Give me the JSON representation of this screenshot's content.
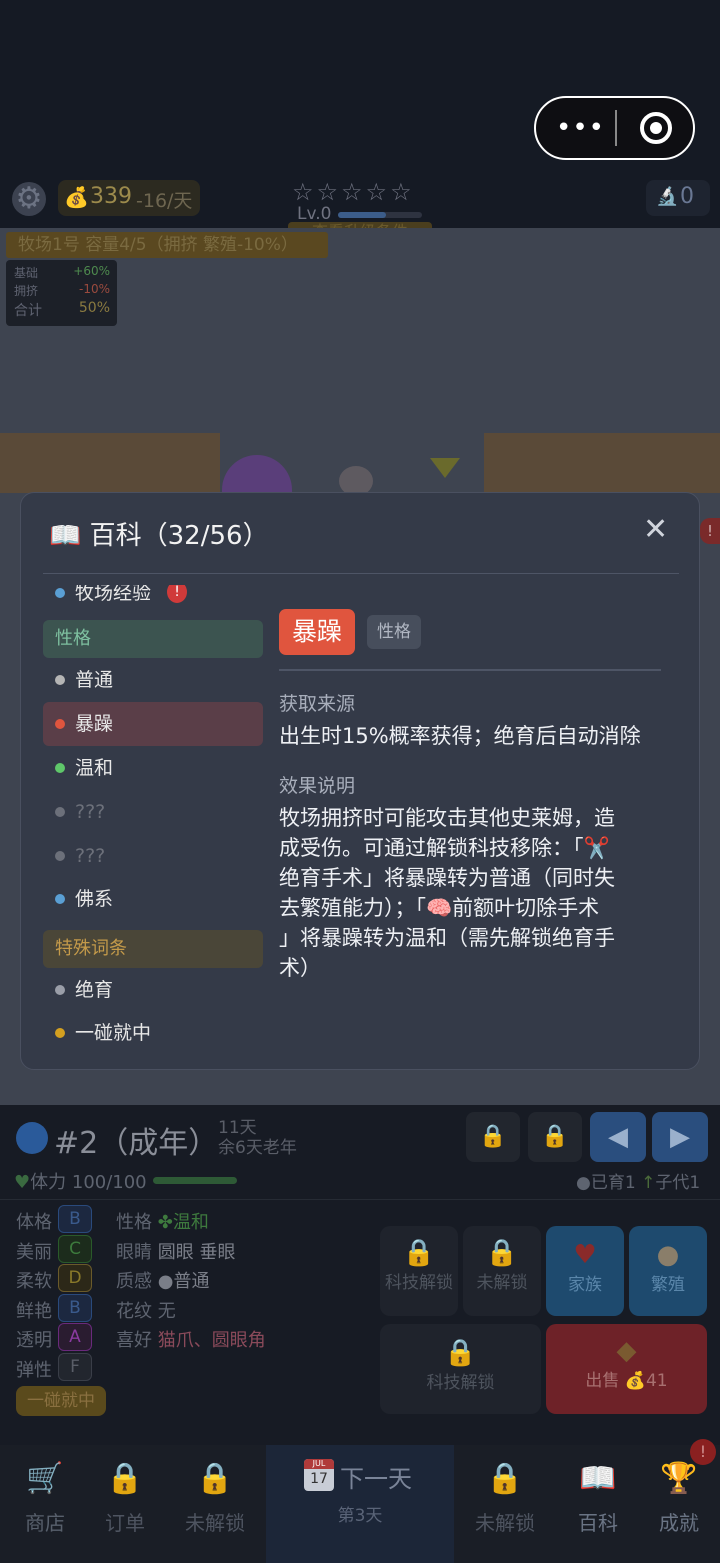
{
  "top": {
    "coins": "339",
    "coins_delta": "-16/天",
    "stars": "☆☆☆☆☆",
    "level": "Lv.0",
    "upgrade_label": "查看升级条件",
    "right_count": "0"
  },
  "farm": {
    "label": "牧场1号  容量4/5（拥挤 繁殖-10%）",
    "stats": [
      {
        "name": "基础",
        "value": "+60%"
      },
      {
        "name": "拥挤",
        "value": "-10%"
      },
      {
        "name": "合计",
        "value": "50%"
      }
    ]
  },
  "modal": {
    "title": "百科（32/56）",
    "close": "✕",
    "sidebar": {
      "partial_item": "牧场经验",
      "cat_personality": "性格",
      "items": [
        {
          "label": "普通",
          "color": "#b5b5b5"
        },
        {
          "label": "暴躁",
          "color": "#e0553e"
        },
        {
          "label": "温和",
          "color": "#5fc76a"
        },
        {
          "label": "???",
          "color": "#6c707a"
        },
        {
          "label": "???",
          "color": "#6c707a"
        },
        {
          "label": "佛系",
          "color": "#5a9fd4"
        }
      ],
      "cat_special": "特殊词条",
      "items2": [
        {
          "label": "绝育",
          "color": "#9a9ea8"
        },
        {
          "label": "一碰就中",
          "color": "#d4a020"
        }
      ]
    },
    "detail": {
      "name": "暴躁",
      "type": "性格",
      "source_heading": "获取来源",
      "source_text": "出生时15%概率获得；绝育后自动消除",
      "effect_heading": "效果说明",
      "effect_lines": [
        "牧场拥挤时可能攻击其他史莱姆，造",
        "成受伤。可通过解锁科技移除：「✂️",
        "绝育手术」将暴躁转为普通（同时失",
        "去繁殖能力）；「🧠前额叶切除手术",
        "」将暴躁转为温和（需先解锁绝育手",
        "术）"
      ]
    }
  },
  "slime": {
    "name": "#2（成年）",
    "age_days": "11天",
    "age_left": "余6天老年",
    "hp": "体力 100/100",
    "bred": "已育1",
    "children": "子代1",
    "attrs": [
      {
        "label": "体格",
        "grade": "B",
        "color": "#4a78c0"
      },
      {
        "label": "美丽",
        "grade": "C",
        "color": "#4a9a4a"
      },
      {
        "label": "柔软",
        "grade": "D",
        "color": "#a0902a"
      },
      {
        "label": "鲜艳",
        "grade": "B",
        "color": "#4a78c0"
      },
      {
        "label": "透明",
        "grade": "A",
        "color": "#9a4ab0"
      },
      {
        "label": "弹性",
        "grade": "F",
        "color": "#6a6e78"
      }
    ],
    "traits": [
      {
        "label": "性格",
        "value": "✤温和"
      },
      {
        "label": "眼睛",
        "value": "圆眼 垂眼"
      },
      {
        "label": "质感",
        "value": "●普通"
      },
      {
        "label": "花纹",
        "value": "无"
      },
      {
        "label": "喜好",
        "value": "猫爪、圆眼角"
      }
    ],
    "chip": "一碰就中"
  },
  "actions": {
    "tech_unlock": "科技解锁",
    "locked": "未解锁",
    "family": "家族",
    "breed": "繁殖",
    "tech_unlock2": "科技解锁",
    "sell": "出售 💰41"
  },
  "nav": {
    "shop": "商店",
    "orders": "订单",
    "locked1": "未解锁",
    "next_day": "下一天",
    "day": "第3天",
    "locked2": "未解锁",
    "wiki": "百科",
    "achieve": "成就",
    "calendar_month": "JUL",
    "calendar_day": "17"
  }
}
